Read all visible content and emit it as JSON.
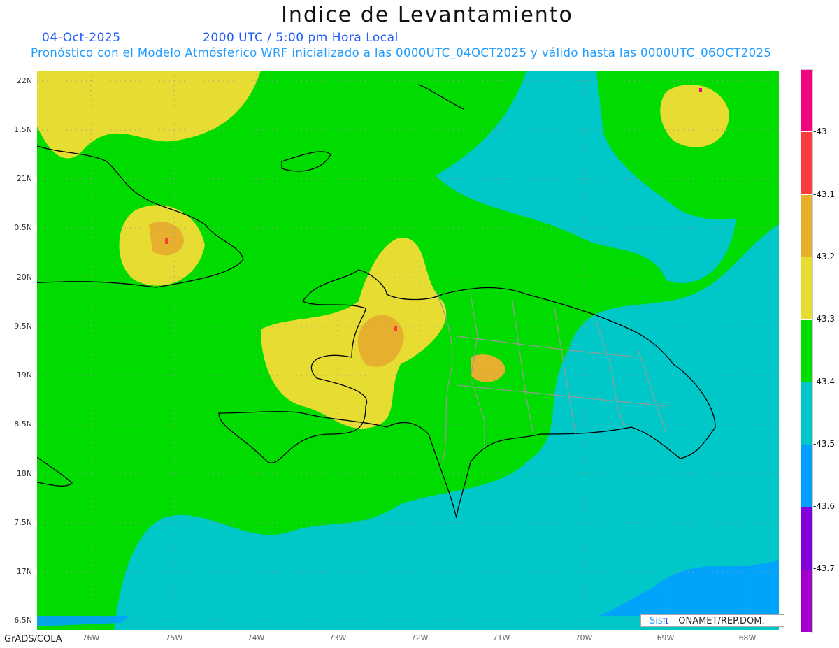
{
  "header": {
    "title": "Indice de Levantamiento",
    "date": "04-Oct-2025",
    "time": "2000 UTC / 5:00 pm Hora Local",
    "subtitle": "Pronóstico con el Modelo Atmósferico WRF inicializado a las 0000UTC_04OCT2025 y válido hasta las  0000UTC_06OCT2025"
  },
  "map": {
    "lat_labels": [
      "22N",
      "1.5N",
      "21N",
      "0.5N",
      "20N",
      "9.5N",
      "19N",
      "8.5N",
      "18N",
      "7.5N",
      "17N",
      "6.5N"
    ],
    "lon_labels": [
      "76W",
      "75W",
      "74W",
      "73W",
      "72W",
      "71W",
      "70W",
      "69W",
      "68W"
    ]
  },
  "colorbar": {
    "ticks": [
      "-43",
      "-43.1",
      "-43.2",
      "-43.3",
      "-43.4",
      "-43.5",
      "-43.6",
      "-43.7"
    ],
    "colors": [
      "#f0047f",
      "#fa3c3c",
      "#e6af2d",
      "#e6dc32",
      "#00dc00",
      "#00c8c8",
      "#00a0ff",
      "#8200dc",
      "#a000c8"
    ]
  },
  "badge": {
    "brand_sis": "Sis",
    "brand_pi": "π",
    "text": " –  ONAMET/REP.DOM."
  },
  "footer": {
    "credit": "GrADS/COLA"
  }
}
